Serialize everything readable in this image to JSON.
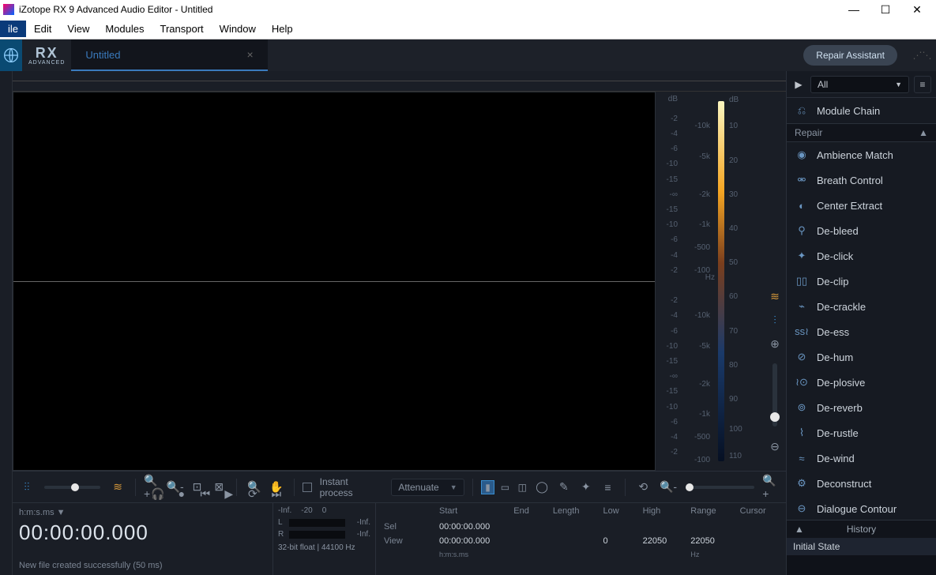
{
  "window": {
    "title": "iZotope RX 9 Advanced Audio Editor - Untitled"
  },
  "menubar": [
    "ile",
    "Edit",
    "View",
    "Modules",
    "Transport",
    "Window",
    "Help"
  ],
  "tab": {
    "title": "Untitled"
  },
  "header": {
    "brand": "RX",
    "brand_sub": "ADVANCED",
    "repair_assistant": "Repair Assistant"
  },
  "scales": {
    "db_header": "dB",
    "db_top": [
      "-2",
      "-4",
      "-6",
      "-10",
      "-15",
      "-∞",
      "-15",
      "-10",
      "-6",
      "-4",
      "-2"
    ],
    "db_bot": [
      "-2",
      "-4",
      "-6",
      "-10",
      "-15",
      "-∞",
      "-15",
      "-10",
      "-6",
      "-4",
      "-2"
    ],
    "freq": [
      "-10k",
      "-5k",
      "-2k",
      "-1k",
      "-500",
      "-100",
      "-10k",
      "-5k",
      "-2k",
      "-1k",
      "-500",
      "-100"
    ],
    "freq_unit": "Hz",
    "cmap_header": "dB",
    "cmap": [
      "10",
      "20",
      "30",
      "40",
      "50",
      "60",
      "70",
      "80",
      "90",
      "100",
      "110"
    ]
  },
  "toolbar": {
    "instant_process": "Instant process",
    "attenuate": "Attenuate"
  },
  "time": {
    "format_label": "h:m:s.ms ▼",
    "big": "00:00:00.000"
  },
  "status": "New file created successfully (50 ms)",
  "meters": {
    "hdrs": [
      "-Inf.",
      "-20",
      "0"
    ],
    "L": "L",
    "R": "R",
    "Linf": "-Inf.",
    "Rinf": "-Inf.",
    "format": "32-bit float | 44100 Hz"
  },
  "selection": {
    "rows": [
      "Sel",
      "View"
    ],
    "cols": [
      "Start",
      "End",
      "Length",
      "Low",
      "High",
      "Range",
      "Cursor"
    ],
    "sel_start": "00:00:00.000",
    "view_start": "00:00:00.000",
    "unit": "h:m:s.ms",
    "hz": "Hz",
    "low": "0",
    "high": "22050",
    "range": "22050"
  },
  "rpanel": {
    "all": "All",
    "modchain": "Module Chain",
    "section": "Repair",
    "modules": [
      "Ambience Match",
      "Breath Control",
      "Center Extract",
      "De-bleed",
      "De-click",
      "De-clip",
      "De-crackle",
      "De-ess",
      "De-hum",
      "De-plosive",
      "De-reverb",
      "De-rustle",
      "De-wind",
      "Deconstruct",
      "Dialogue Contour"
    ],
    "mod_icons": [
      "◉",
      "⚮",
      "◐",
      "⚲",
      "✦",
      "▯▯",
      "⌁",
      "ss≀",
      "⊘",
      "≀⊙",
      "⊚",
      "⌇",
      "≈",
      "⚙",
      "⊖"
    ]
  },
  "history": {
    "title": "History",
    "item": "Initial State"
  }
}
